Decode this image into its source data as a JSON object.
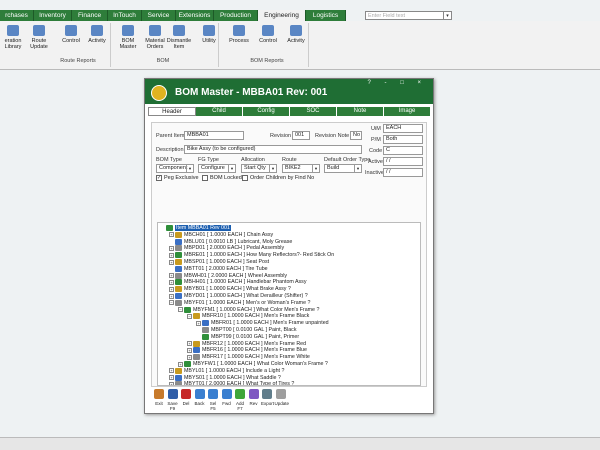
{
  "main_tabs": [
    {
      "label": "rchases"
    },
    {
      "label": "Inventory"
    },
    {
      "label": "Finance"
    },
    {
      "label": "InTouch"
    },
    {
      "label": "Service"
    },
    {
      "label": "Extensions"
    },
    {
      "label": "Production"
    },
    {
      "label": "Engineering",
      "active": true
    },
    {
      "label": "Logistics"
    }
  ],
  "search": {
    "placeholder": "Enter Field text"
  },
  "ribbon": {
    "buttons": [
      "eration\nLibrary",
      "Route\nUpdate",
      "Control",
      "Activity",
      "BOM\nMaster",
      "Material\nOrders",
      "Dismantle\nItem",
      "Utility",
      "Process",
      "Control",
      "Activity"
    ],
    "groups": [
      "Route Reports",
      "BOM",
      "BOM Reports"
    ]
  },
  "window": {
    "title": "BOM Master - MBBA01  Rev: 001",
    "controls": "? - □ ×",
    "tabs": [
      "Header",
      "Child",
      "Config",
      "SOC",
      "Note",
      "Image"
    ],
    "parent_item_label": "Parent Item",
    "parent_item": "MBBA01",
    "revision_label": "Revision",
    "revision": "001",
    "revision_note_label": "Revision Note",
    "revision_note": "No",
    "description_label": "Description",
    "description": "Bike Assy (to be configured)",
    "uim_label": "UiM",
    "uim": "EACH",
    "pm_label": "P/M",
    "pm": "Both",
    "code_label": "Code",
    "code": "C",
    "active_label": "Active",
    "active": "/ /",
    "inactive_label": "Inactive",
    "inactive": "/ /",
    "bom_type_label": "BOM Type",
    "bom_type": "Component",
    "fg_type_label": "FG Type",
    "fg_type": "Configure",
    "allocation_label": "Allocation",
    "allocation": "Start Qty",
    "route_label": "Route",
    "route": "BIKE2",
    "default_order_label": "Default Order Type",
    "default_order": "Build",
    "peg_exclusive": "Peg Exclusive",
    "bom_locked": "BOM Locked",
    "order_children": "Order Children by Find No"
  },
  "tree": [
    {
      "text": "Item MBBA01 Rev 001",
      "level": 0,
      "selected": true
    },
    {
      "text": "MBCH01 [ 1.0000 EACH ] Chain Assy",
      "level": 1,
      "exp": "+"
    },
    {
      "text": "MBLU01 [ 0.0010 LB ] Lubricant, Moly Grease",
      "level": 1
    },
    {
      "text": "MBPD01 [ 2.0000 EACH ] Pedal Assembly",
      "level": 1,
      "exp": "+"
    },
    {
      "text": "MBRE01 [ 1.0000 EACH ] How Many Reflectors?- Red Stick On",
      "level": 1,
      "exp": "+"
    },
    {
      "text": "MBSP01 [ 1.0000 EACH ] Seat Post",
      "level": 1,
      "exp": "+"
    },
    {
      "text": "MBTT01 [ 2.0000 EACH ] Tire Tube",
      "level": 1
    },
    {
      "text": "MBWH01 [ 2.0000 EACH ] Wheel Assembly",
      "level": 1,
      "exp": "+"
    },
    {
      "text": "MBHH01 [ 1.0000 EACH ] Handlebar Phantom Assy",
      "level": 1,
      "exp": "+"
    },
    {
      "text": "MBYB01 [ 1.0000 EACH ] What Brake Assy ?",
      "level": 1,
      "exp": "+"
    },
    {
      "text": "MBYD01 [ 1.0000 EACH ] What Derailleur (Shifter) ?",
      "level": 1,
      "exp": "+"
    },
    {
      "text": "MBYF01 [ 1.0000 EACH ] Men's or Woman's Frame ?",
      "level": 1,
      "exp": "-"
    },
    {
      "text": "MBYFM1 [ 1.0000 EACH ] What Color Men's Frame ?",
      "level": 2,
      "exp": "-"
    },
    {
      "text": "MBFR10 [ 1.0000 EACH ] Men's Frame Black",
      "level": 3,
      "exp": "-"
    },
    {
      "text": "MBFR01 [ 1.0000 EACH ] Men's Frame unpainted",
      "level": 4,
      "exp": "+"
    },
    {
      "text": "MBPT00 [ 0.0100 GAL ] Paint, Black",
      "level": 4
    },
    {
      "text": "MBPT99 [ 0.0100 GAL ] Paint, Primer",
      "level": 4
    },
    {
      "text": "MBFR12 [ 1.0000 EACH ] Men's Frame Red",
      "level": 3,
      "exp": "+"
    },
    {
      "text": "MBFR16 [ 1.0000 EACH ] Men's Frame Blue",
      "level": 3,
      "exp": "+"
    },
    {
      "text": "MBFR17 [ 1.0000 EACH ] Men's Frame White",
      "level": 3,
      "exp": "+"
    },
    {
      "text": "MBYFW1 [ 1.0000 EACH ] What Color Woman's Frame ?",
      "level": 2,
      "exp": "+"
    },
    {
      "text": "MBYL01 [ 1.0000 EACH ] Include a Light ?",
      "level": 1,
      "exp": "+"
    },
    {
      "text": "MBYS01 [ 1.0000 EACH ] What Saddle ?",
      "level": 1,
      "exp": "+"
    },
    {
      "text": "MBYT01 [ 2.0000 EACH ] What Type of Tires ?",
      "level": 1,
      "exp": "+"
    }
  ],
  "toolbar": [
    {
      "label": "Exit",
      "icon": "home-icon",
      "color": "#c77a2b"
    },
    {
      "label": "Save F9",
      "icon": "save-icon",
      "color": "#2f5ea8"
    },
    {
      "label": "Del",
      "icon": "delete-icon",
      "color": "#c62828"
    },
    {
      "label": "Back",
      "icon": "arrow-left-icon",
      "color": "#3a7fd0"
    },
    {
      "label": "Sel F5",
      "icon": "search-icon",
      "color": "#3a7fd0"
    },
    {
      "label": "Fwd",
      "icon": "arrow-right-icon",
      "color": "#3a7fd0"
    },
    {
      "label": "Add F7",
      "icon": "add-icon",
      "color": "#3fa63a"
    },
    {
      "label": "Rev",
      "icon": "revision-icon",
      "color": "#7e57c2"
    },
    {
      "label": "Export",
      "icon": "export-icon",
      "color": "#607d8b"
    },
    {
      "label": "Update",
      "icon": "update-icon",
      "color": "#9e9e9e"
    }
  ],
  "colors": {
    "brand": "#2e7d3a",
    "title": "#1f6e34",
    "selection": "#1c5fb0"
  }
}
